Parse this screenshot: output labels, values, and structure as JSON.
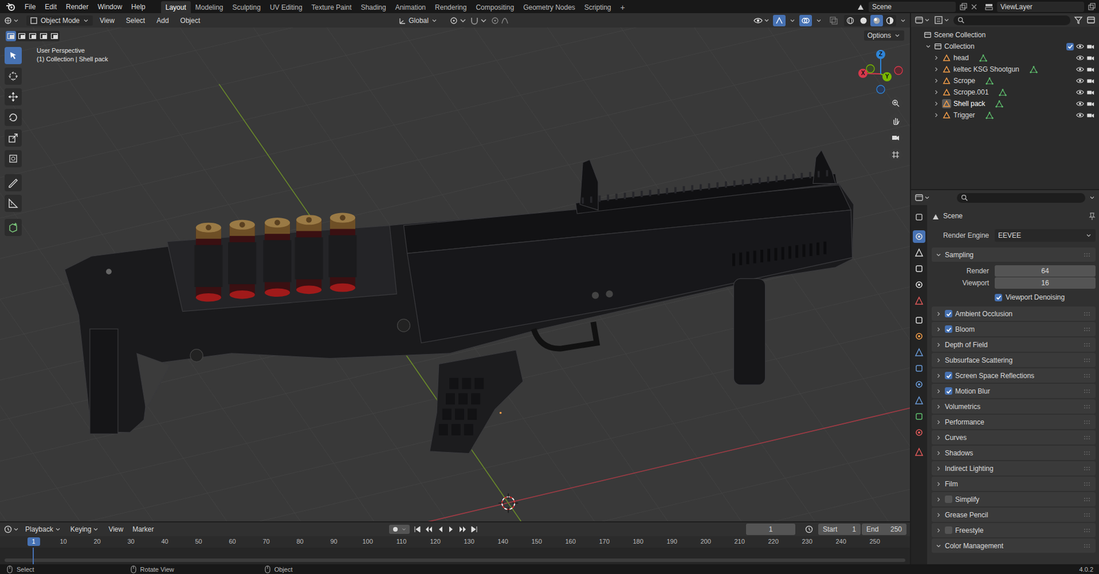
{
  "topbar": {
    "menus": [
      "File",
      "Edit",
      "Render",
      "Window",
      "Help"
    ],
    "workspaces": [
      {
        "label": "Layout",
        "selected": true
      },
      {
        "label": "Modeling",
        "selected": false
      },
      {
        "label": "Sculpting",
        "selected": false
      },
      {
        "label": "UV Editing",
        "selected": false
      },
      {
        "label": "Texture Paint",
        "selected": false
      },
      {
        "label": "Shading",
        "selected": false
      },
      {
        "label": "Animation",
        "selected": false
      },
      {
        "label": "Rendering",
        "selected": false
      },
      {
        "label": "Compositing",
        "selected": false
      },
      {
        "label": "Geometry Nodes",
        "selected": false
      },
      {
        "label": "Scripting",
        "selected": false
      }
    ],
    "add_tab": "+",
    "scene": "Scene",
    "view_layer": "ViewLayer"
  },
  "viewport": {
    "header": {
      "mode": "Object Mode",
      "menus": [
        "View",
        "Select",
        "Add",
        "Object"
      ],
      "orientation": "Global",
      "options": "Options",
      "shading": [
        {
          "selected": false
        },
        {
          "selected": false
        },
        {
          "selected": true
        },
        {
          "selected": false
        }
      ]
    },
    "select_modes": [
      {
        "selected": true
      },
      {
        "selected": false
      },
      {
        "selected": false
      },
      {
        "selected": false
      },
      {
        "selected": false
      }
    ],
    "tools": [
      {
        "selected": true
      },
      {
        "selected": false
      },
      {
        "selected": false
      },
      {
        "selected": false
      },
      {
        "selected": false
      },
      {
        "selected": false
      },
      {
        "selected": false
      },
      {
        "selected": false
      },
      {
        "selected": false
      }
    ],
    "overlay": {
      "view": "User Perspective",
      "context": "(1) Collection | Shell pack"
    },
    "gizmo": {
      "x": "X",
      "y": "Y",
      "z": "Z"
    }
  },
  "outliner": {
    "root": "Scene Collection",
    "collection": {
      "name": "Collection",
      "checked": true,
      "expanded": true
    },
    "items": [
      {
        "name": "head",
        "active": false
      },
      {
        "name": "keltec KSG Shootgun",
        "active": false
      },
      {
        "name": "Scrope",
        "active": false
      },
      {
        "name": "Scrope.001",
        "active": false
      },
      {
        "name": "Shell pack",
        "active": true
      },
      {
        "name": "Trigger",
        "active": false
      }
    ]
  },
  "properties": {
    "tabs": [
      {
        "selected": false
      },
      {
        "selected": true
      },
      {
        "selected": false
      },
      {
        "selected": false
      },
      {
        "selected": false
      },
      {
        "selected": false
      },
      {
        "selected": false
      },
      {
        "selected": false
      },
      {
        "selected": false
      },
      {
        "selected": false
      },
      {
        "selected": false
      },
      {
        "selected": false
      },
      {
        "selected": false
      },
      {
        "selected": false
      },
      {
        "selected": false
      }
    ],
    "context": "Scene",
    "render_engine": {
      "label": "Render Engine",
      "value": "EEVEE"
    },
    "sampling": {
      "title": "Sampling",
      "expanded": true,
      "fields": [
        {
          "label": "Render",
          "value": "64"
        },
        {
          "label": "Viewport",
          "value": "16"
        }
      ],
      "denoising": {
        "label": "Viewport Denoising",
        "checked": true
      }
    },
    "panels": [
      {
        "title": "Ambient Occlusion",
        "kind": "checkbox",
        "checked": true,
        "expanded": false
      },
      {
        "title": "Bloom",
        "kind": "checkbox",
        "checked": true,
        "expanded": false
      },
      {
        "title": "Depth of Field",
        "kind": "plain",
        "expanded": false
      },
      {
        "title": "Subsurface Scattering",
        "kind": "plain",
        "expanded": false
      },
      {
        "title": "Screen Space Reflections",
        "kind": "checkbox",
        "checked": true,
        "expanded": false
      },
      {
        "title": "Motion Blur",
        "kind": "checkbox",
        "checked": true,
        "expanded": false
      },
      {
        "title": "Volumetrics",
        "kind": "plain",
        "expanded": false
      },
      {
        "title": "Performance",
        "kind": "plain",
        "expanded": false
      },
      {
        "title": "Curves",
        "kind": "plain",
        "expanded": false
      },
      {
        "title": "Shadows",
        "kind": "plain",
        "expanded": false
      },
      {
        "title": "Indirect Lighting",
        "kind": "plain",
        "expanded": false
      },
      {
        "title": "Film",
        "kind": "plain",
        "expanded": false
      },
      {
        "title": "Simplify",
        "kind": "checkbox",
        "checked": false,
        "expanded": false
      },
      {
        "title": "Grease Pencil",
        "kind": "plain",
        "expanded": false
      },
      {
        "title": "Freestyle",
        "kind": "checkbox",
        "checked": false,
        "expanded": false
      },
      {
        "title": "Color Management",
        "kind": "plain",
        "expanded": true
      }
    ]
  },
  "timeline": {
    "menus": [
      {
        "label": "Playback",
        "dropdown": true
      },
      {
        "label": "Keying",
        "dropdown": true
      },
      {
        "label": "View",
        "dropdown": false
      },
      {
        "label": "Marker",
        "dropdown": false
      }
    ],
    "current_frame": "1",
    "start": {
      "label": "Start",
      "value": "1"
    },
    "end": {
      "label": "End",
      "value": "250"
    },
    "playhead": "1",
    "ruler": [
      "10",
      "20",
      "30",
      "40",
      "50",
      "60",
      "70",
      "80",
      "90",
      "100",
      "110",
      "120",
      "130",
      "140",
      "150",
      "160",
      "170",
      "180",
      "190",
      "200",
      "210",
      "220",
      "230",
      "240",
      "250"
    ]
  },
  "status_bar": {
    "items": [
      "Select",
      "Rotate View",
      "Object"
    ],
    "version": "4.0.2"
  }
}
